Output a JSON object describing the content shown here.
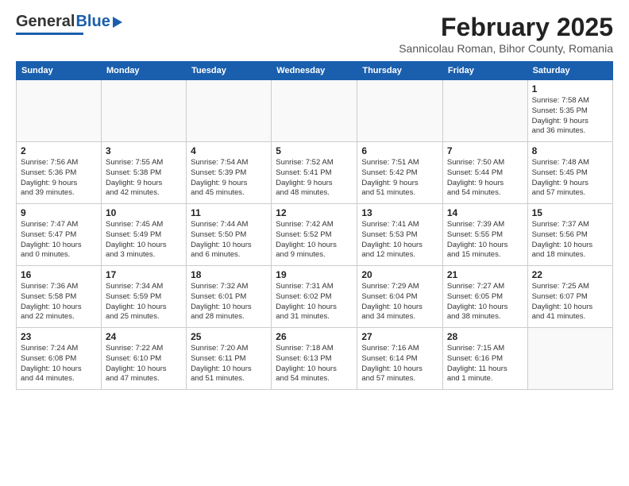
{
  "header": {
    "logo_general": "General",
    "logo_blue": "Blue",
    "month_title": "February 2025",
    "subtitle": "Sannicolau Roman, Bihor County, Romania"
  },
  "weekdays": [
    "Sunday",
    "Monday",
    "Tuesday",
    "Wednesday",
    "Thursday",
    "Friday",
    "Saturday"
  ],
  "weeks": [
    [
      {
        "num": "",
        "info": ""
      },
      {
        "num": "",
        "info": ""
      },
      {
        "num": "",
        "info": ""
      },
      {
        "num": "",
        "info": ""
      },
      {
        "num": "",
        "info": ""
      },
      {
        "num": "",
        "info": ""
      },
      {
        "num": "1",
        "info": "Sunrise: 7:58 AM\nSunset: 5:35 PM\nDaylight: 9 hours\nand 36 minutes."
      }
    ],
    [
      {
        "num": "2",
        "info": "Sunrise: 7:56 AM\nSunset: 5:36 PM\nDaylight: 9 hours\nand 39 minutes."
      },
      {
        "num": "3",
        "info": "Sunrise: 7:55 AM\nSunset: 5:38 PM\nDaylight: 9 hours\nand 42 minutes."
      },
      {
        "num": "4",
        "info": "Sunrise: 7:54 AM\nSunset: 5:39 PM\nDaylight: 9 hours\nand 45 minutes."
      },
      {
        "num": "5",
        "info": "Sunrise: 7:52 AM\nSunset: 5:41 PM\nDaylight: 9 hours\nand 48 minutes."
      },
      {
        "num": "6",
        "info": "Sunrise: 7:51 AM\nSunset: 5:42 PM\nDaylight: 9 hours\nand 51 minutes."
      },
      {
        "num": "7",
        "info": "Sunrise: 7:50 AM\nSunset: 5:44 PM\nDaylight: 9 hours\nand 54 minutes."
      },
      {
        "num": "8",
        "info": "Sunrise: 7:48 AM\nSunset: 5:45 PM\nDaylight: 9 hours\nand 57 minutes."
      }
    ],
    [
      {
        "num": "9",
        "info": "Sunrise: 7:47 AM\nSunset: 5:47 PM\nDaylight: 10 hours\nand 0 minutes."
      },
      {
        "num": "10",
        "info": "Sunrise: 7:45 AM\nSunset: 5:49 PM\nDaylight: 10 hours\nand 3 minutes."
      },
      {
        "num": "11",
        "info": "Sunrise: 7:44 AM\nSunset: 5:50 PM\nDaylight: 10 hours\nand 6 minutes."
      },
      {
        "num": "12",
        "info": "Sunrise: 7:42 AM\nSunset: 5:52 PM\nDaylight: 10 hours\nand 9 minutes."
      },
      {
        "num": "13",
        "info": "Sunrise: 7:41 AM\nSunset: 5:53 PM\nDaylight: 10 hours\nand 12 minutes."
      },
      {
        "num": "14",
        "info": "Sunrise: 7:39 AM\nSunset: 5:55 PM\nDaylight: 10 hours\nand 15 minutes."
      },
      {
        "num": "15",
        "info": "Sunrise: 7:37 AM\nSunset: 5:56 PM\nDaylight: 10 hours\nand 18 minutes."
      }
    ],
    [
      {
        "num": "16",
        "info": "Sunrise: 7:36 AM\nSunset: 5:58 PM\nDaylight: 10 hours\nand 22 minutes."
      },
      {
        "num": "17",
        "info": "Sunrise: 7:34 AM\nSunset: 5:59 PM\nDaylight: 10 hours\nand 25 minutes."
      },
      {
        "num": "18",
        "info": "Sunrise: 7:32 AM\nSunset: 6:01 PM\nDaylight: 10 hours\nand 28 minutes."
      },
      {
        "num": "19",
        "info": "Sunrise: 7:31 AM\nSunset: 6:02 PM\nDaylight: 10 hours\nand 31 minutes."
      },
      {
        "num": "20",
        "info": "Sunrise: 7:29 AM\nSunset: 6:04 PM\nDaylight: 10 hours\nand 34 minutes."
      },
      {
        "num": "21",
        "info": "Sunrise: 7:27 AM\nSunset: 6:05 PM\nDaylight: 10 hours\nand 38 minutes."
      },
      {
        "num": "22",
        "info": "Sunrise: 7:25 AM\nSunset: 6:07 PM\nDaylight: 10 hours\nand 41 minutes."
      }
    ],
    [
      {
        "num": "23",
        "info": "Sunrise: 7:24 AM\nSunset: 6:08 PM\nDaylight: 10 hours\nand 44 minutes."
      },
      {
        "num": "24",
        "info": "Sunrise: 7:22 AM\nSunset: 6:10 PM\nDaylight: 10 hours\nand 47 minutes."
      },
      {
        "num": "25",
        "info": "Sunrise: 7:20 AM\nSunset: 6:11 PM\nDaylight: 10 hours\nand 51 minutes."
      },
      {
        "num": "26",
        "info": "Sunrise: 7:18 AM\nSunset: 6:13 PM\nDaylight: 10 hours\nand 54 minutes."
      },
      {
        "num": "27",
        "info": "Sunrise: 7:16 AM\nSunset: 6:14 PM\nDaylight: 10 hours\nand 57 minutes."
      },
      {
        "num": "28",
        "info": "Sunrise: 7:15 AM\nSunset: 6:16 PM\nDaylight: 11 hours\nand 1 minute."
      },
      {
        "num": "",
        "info": ""
      }
    ]
  ]
}
